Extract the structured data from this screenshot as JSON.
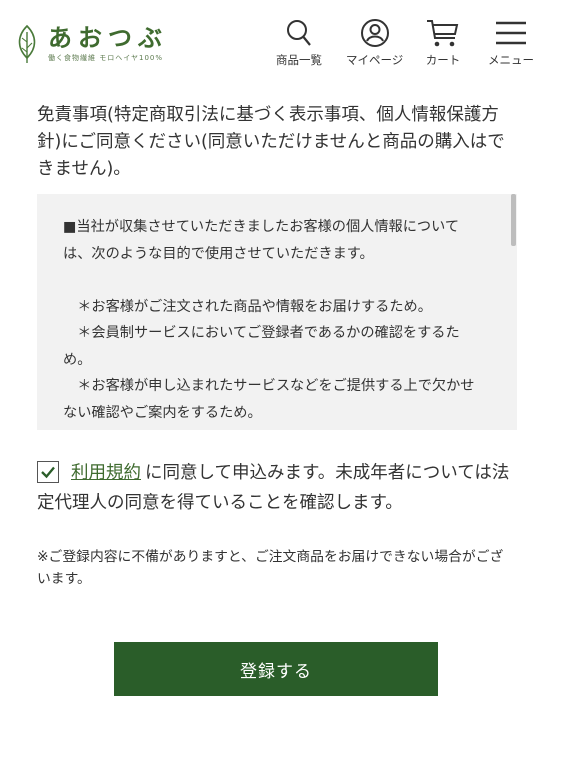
{
  "header": {
    "logo_name": "あおつぶ",
    "logo_tagline": "働く食物繊維 モロヘイヤ100%",
    "nav": [
      {
        "label": "商品一覧",
        "icon": "search-icon"
      },
      {
        "label": "マイページ",
        "icon": "user-icon"
      },
      {
        "label": "カート",
        "icon": "cart-icon"
      },
      {
        "label": "メニュー",
        "icon": "hamburger-menu-icon"
      }
    ]
  },
  "notice": "免責事項(特定商取引法に基づく表示事項、個人情報保護方針)にご同意ください(同意いただけませんと商品の購入はできません)。",
  "policy_text": "■当社が収集させていただきましたお客様の個人情報については、次のような目的で使用させていただきます。\n\n　＊お客様がご注文された商品や情報をお届けするため。\n　＊会員制サービスにおいてご登録者であるかの確認をするため。\n　＊お客様が申し込まれたサービスなどをご提供する上で欠かせない確認やご案内をするため。\n　＊お客様のお役に立つであろうと当社が判断した当社及び当",
  "consent": {
    "checked": true,
    "terms_link": "利用規約",
    "text": "に同意して申込みます。未成年者については法定代理人の同意を得ていることを確認します。"
  },
  "note": "※ご登録内容に不備がありますと、ご注文商品をお届けできない場合がございます。",
  "submit_label": "登録する",
  "colors": {
    "brand_green": "#2a5d29",
    "link_green": "#3f6b2f",
    "policy_bg": "#f2f2f2"
  }
}
